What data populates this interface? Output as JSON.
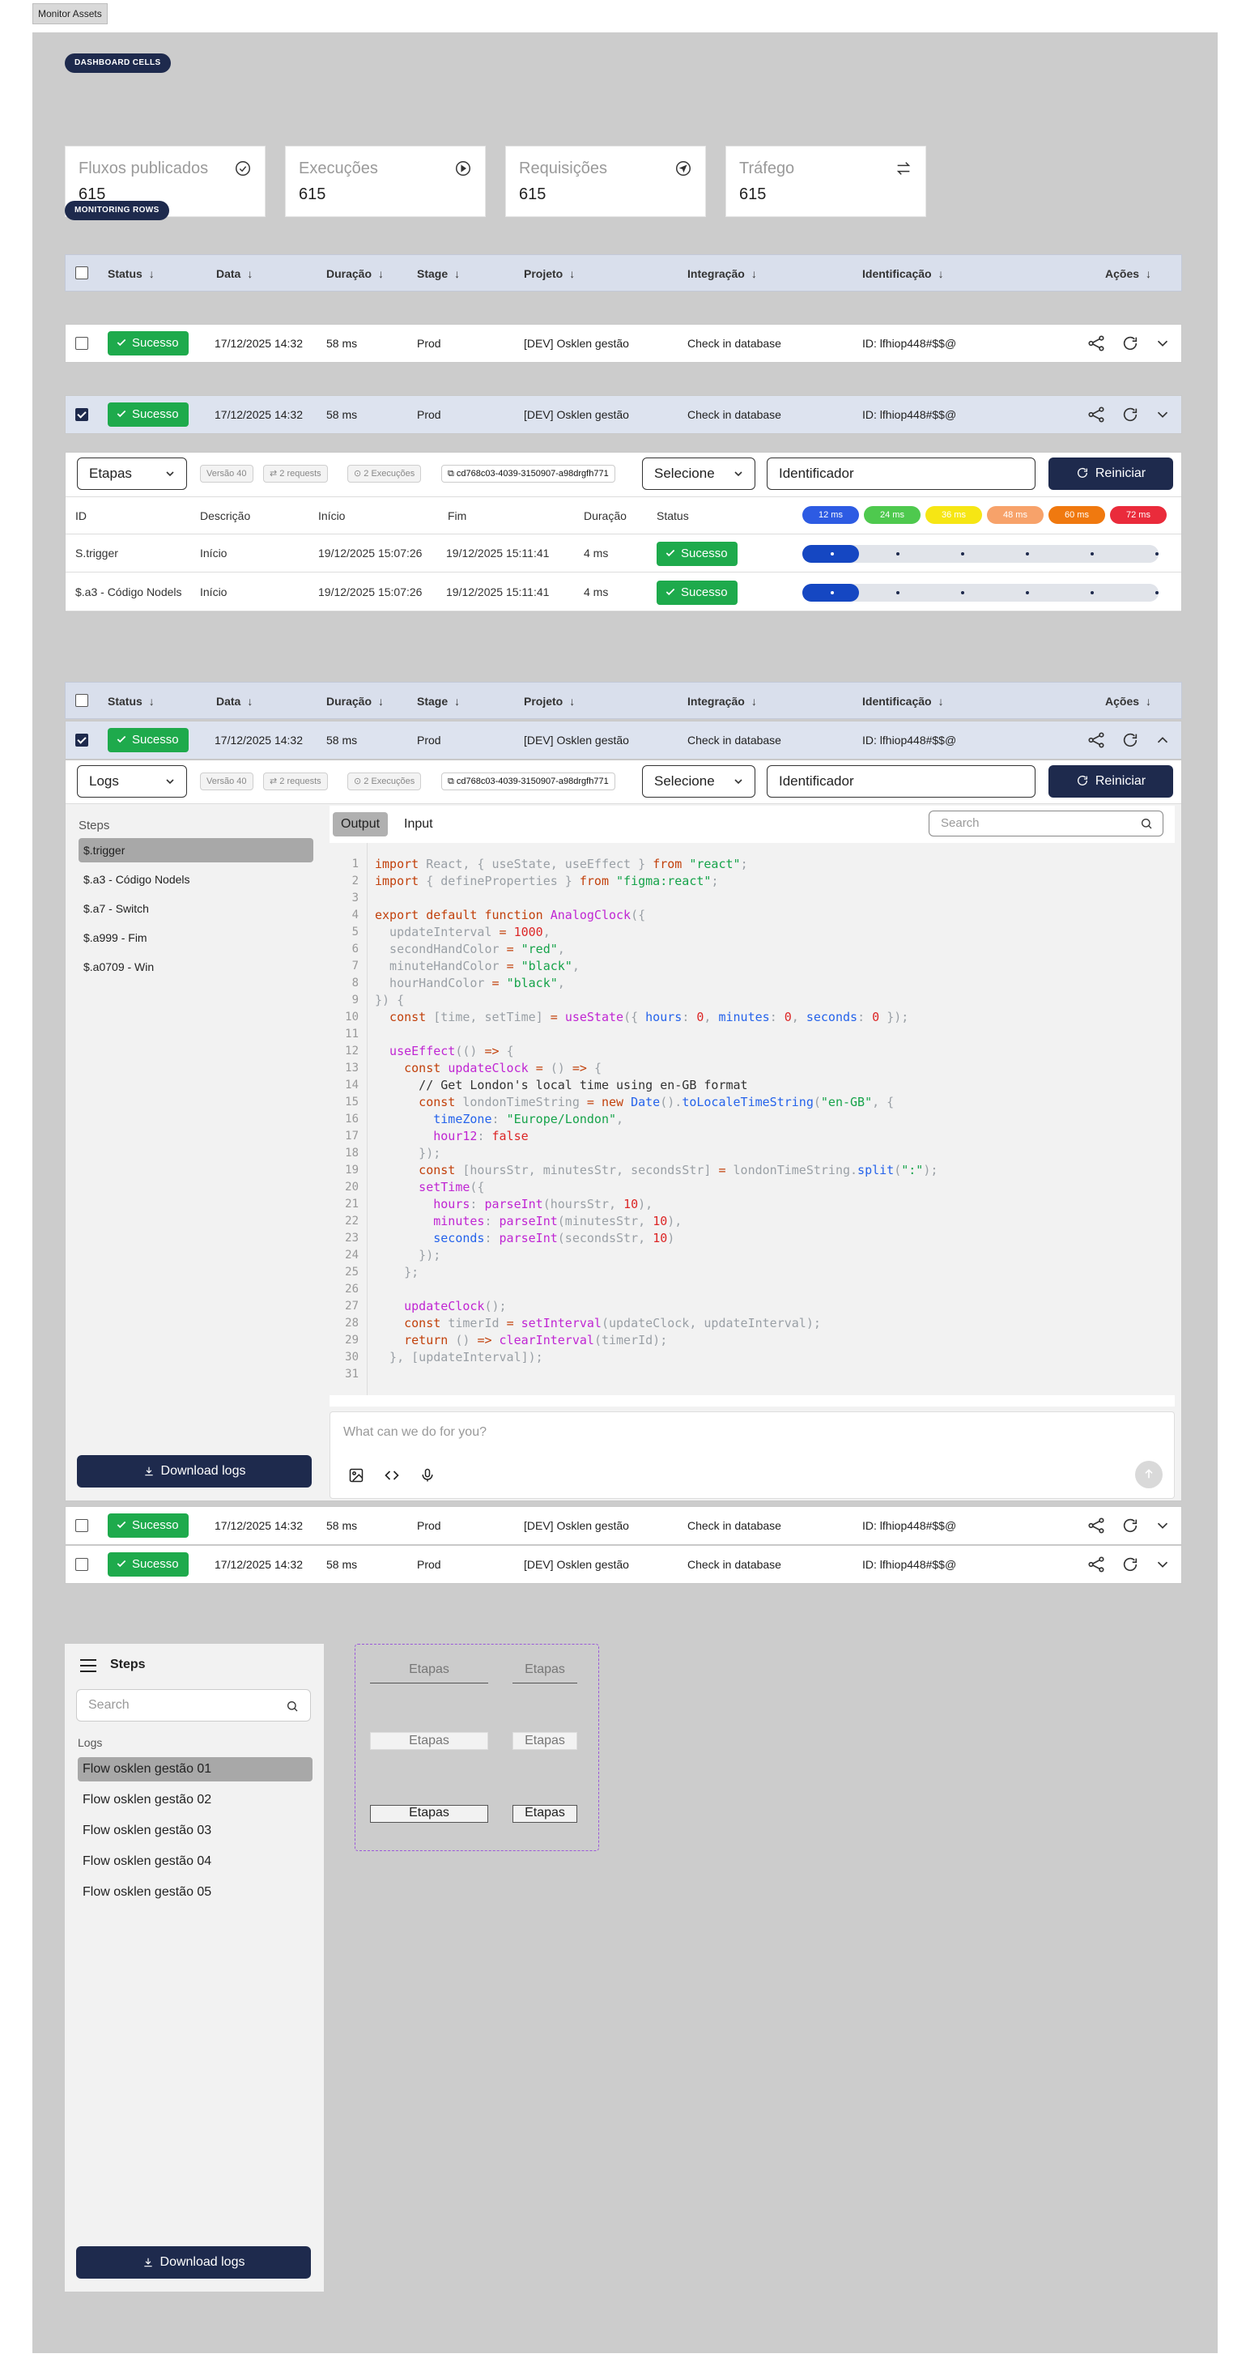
{
  "window": {
    "title": "Monitor Assets"
  },
  "sections": {
    "dashboard_cells": "DASHBOARD CELLS",
    "monitoring_rows": "MONITORING ROWS"
  },
  "cards": [
    {
      "title": "Fluxos publicados",
      "value": "615",
      "icon": "check-circle-icon"
    },
    {
      "title": "Execuções",
      "value": "615",
      "icon": "play-circle-icon"
    },
    {
      "title": "Requisições",
      "value": "615",
      "icon": "navigation-circle-icon"
    },
    {
      "title": "Tráfego",
      "value": "615",
      "icon": "swap-arrows-icon"
    }
  ],
  "table": {
    "columns": [
      "Status",
      "Data",
      "Duração",
      "Stage",
      "Projeto",
      "Integração",
      "Identificação",
      "Ações"
    ],
    "row": {
      "status": "Sucesso",
      "date": "17/12/2025 14:32",
      "duration": "58 ms",
      "stage": "Prod",
      "project": "[DEV] Osklen gestão",
      "integration": "Check in database",
      "id": "ID: lfhiop448#$$@"
    }
  },
  "toolbar": {
    "select_etapas": "Etapas",
    "select_logs": "Logs",
    "version": "Versão 40",
    "requests": "2 requests",
    "executions": "2 Execuções",
    "hash": "cd768c03-4039-3150907-a98drgfh771",
    "select_label": "Selecione",
    "identifier": "Identificador",
    "restart": "Reiniciar"
  },
  "steps_table": {
    "columns": [
      "ID",
      "Descrição",
      "Início",
      "Fim",
      "Duração",
      "Status"
    ],
    "timeline": [
      "12 ms",
      "24 ms",
      "36 ms",
      "48 ms",
      "60 ms",
      "72 ms"
    ],
    "timeline_colors": [
      "#2d5be3",
      "#4ec94e",
      "#f6e614",
      "#f7a26a",
      "#f0790f",
      "#ea2b3b"
    ],
    "rows": [
      {
        "id": "S.trigger",
        "desc": "Início",
        "start": "19/12/2025 15:07:26",
        "end": "19/12/2025 15:11:41",
        "dur": "4 ms",
        "status": "Sucesso",
        "progress": 0.16
      },
      {
        "id": "$.a3 - Código Nodels",
        "desc": "Início",
        "start": "19/12/2025 15:07:26",
        "end": "19/12/2025 15:11:41",
        "dur": "4 ms",
        "status": "Sucesso",
        "progress": 0.16
      }
    ]
  },
  "logs": {
    "steps_title": "Steps",
    "steps": [
      "$.trigger",
      "$.a3 - Código Nodels",
      "$.a7 - Switch",
      "$.a999 - Fim",
      "$.a0709 - Win"
    ],
    "tab_output": "Output",
    "tab_input": "Input",
    "search_placeholder": "Search",
    "download": "Download logs",
    "prompt_placeholder": "What can we do for you?"
  },
  "sidebar": {
    "title": "Steps",
    "search_placeholder": "Search",
    "group": "Logs",
    "items": [
      "Flow osklen gestão 01",
      "Flow osklen gestão 02",
      "Flow osklen gestão 03",
      "Flow osklen gestão 04",
      "Flow osklen gestão 05"
    ],
    "download": "Download logs"
  },
  "variants": {
    "label": "Etapas"
  }
}
